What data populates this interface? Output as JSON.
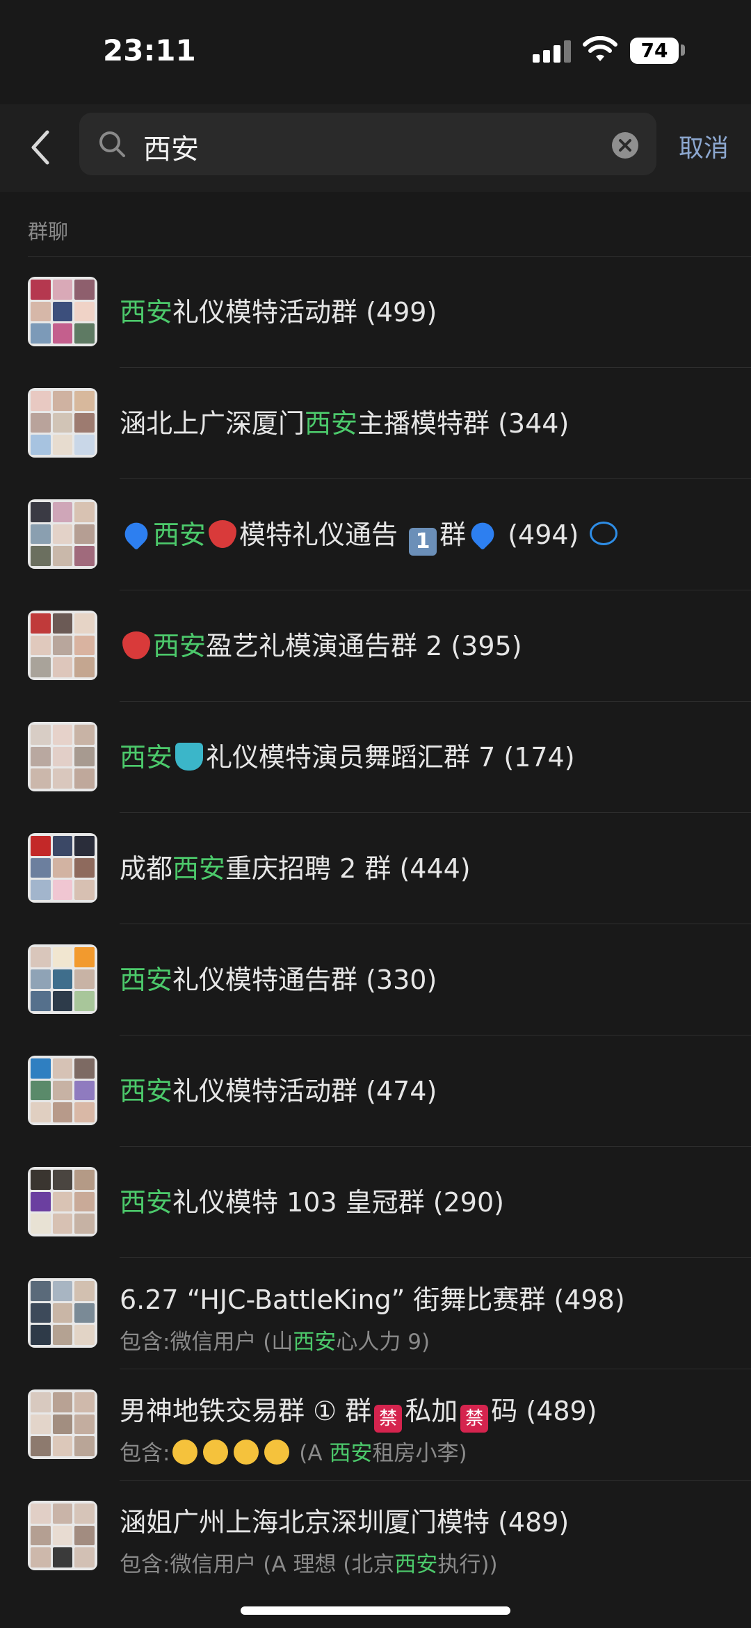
{
  "status_bar": {
    "time": "23:11",
    "battery": "74"
  },
  "search": {
    "query": "西安",
    "cancel_label": "取消"
  },
  "section_title": "群聊",
  "results": [
    {
      "parts": [
        {
          "t": "西安",
          "hl": true
        },
        {
          "t": "礼仪模特活动群 (499)"
        }
      ],
      "sub": null,
      "avatar": [
        "#b5384f",
        "#d9a9b7",
        "#8e5f6d",
        "#d6b7a8",
        "#3c4f7c",
        "#f0d3c7",
        "#7c9ab8",
        "#c45f8d",
        "#5e7a63"
      ]
    },
    {
      "parts": [
        {
          "t": "涵北上广深厦门"
        },
        {
          "t": "西安",
          "hl": true
        },
        {
          "t": "主播模特群 (344)"
        }
      ],
      "sub": null,
      "avatar": [
        "#e8c9c2",
        "#cfb2a1",
        "#d7b89c",
        "#b9a39b",
        "#d1c4b6",
        "#9d7b70",
        "#a7c3e0",
        "#e7dccf",
        "#c9d7e8"
      ]
    },
    {
      "parts": [
        {
          "e": "heart"
        },
        {
          "t": "西安",
          "hl": true
        },
        {
          "e": "straw"
        },
        {
          "t": "模特礼仪通告 "
        },
        {
          "e": "one",
          "t": "1"
        },
        {
          "t": "群"
        },
        {
          "e": "heart"
        },
        {
          "t": " (494) "
        },
        {
          "e": "chat"
        }
      ],
      "sub": null,
      "avatar": [
        "#3a3a44",
        "#cfa6b8",
        "#d8c2b2",
        "#8a9fb0",
        "#e3d2c8",
        "#b59e93",
        "#6b6f5f",
        "#c9b8aa",
        "#a06a7c"
      ]
    },
    {
      "parts": [
        {
          "e": "straw"
        },
        {
          "t": "西安",
          "hl": true
        },
        {
          "t": "盈艺礼模演通告群 2 (395)"
        }
      ],
      "sub": null,
      "avatar": [
        "#c03a3a",
        "#6b5a55",
        "#e6d4c6",
        "#e0c9bd",
        "#b8a69c",
        "#d9b3a0",
        "#a9a39a",
        "#ddc6bb",
        "#c4a690"
      ]
    },
    {
      "parts": [
        {
          "t": "西安",
          "hl": true
        },
        {
          "e": "dress"
        },
        {
          "t": "礼仪模特演员舞蹈汇群 7 (174)"
        }
      ],
      "sub": null,
      "avatar": [
        "#d8cdc5",
        "#e6d2ca",
        "#c8b3a5",
        "#b9a8a0",
        "#e2cfc8",
        "#a79a90",
        "#cbb7ab",
        "#d9c7bd",
        "#bfa89b"
      ]
    },
    {
      "parts": [
        {
          "t": "成都"
        },
        {
          "t": "西安",
          "hl": true
        },
        {
          "t": "重庆招聘 2 群 (444)"
        }
      ],
      "sub": null,
      "avatar": [
        "#c32828",
        "#3b4866",
        "#2a2d3a",
        "#6c7f9e",
        "#d2b3a2",
        "#8e6a5d",
        "#a2b5cc",
        "#f0c6d2",
        "#d7c0b2"
      ]
    },
    {
      "parts": [
        {
          "t": "西安",
          "hl": true
        },
        {
          "t": "礼仪模特通告群 (330)"
        }
      ],
      "sub": null,
      "avatar": [
        "#d9c6bb",
        "#f1e6d0",
        "#f29a2e",
        "#8fa3b6",
        "#3f6e8c",
        "#c8b3a5",
        "#55708c",
        "#2d3b4a",
        "#a8c69a"
      ]
    },
    {
      "parts": [
        {
          "t": "西安",
          "hl": true
        },
        {
          "t": "礼仪模特活动群 (474)"
        }
      ],
      "sub": null,
      "avatar": [
        "#2f7fc1",
        "#d6c2b5",
        "#7d6a63",
        "#5a8a6a",
        "#c7b2a4",
        "#8f7bbf",
        "#e0cfc1",
        "#b79a8a",
        "#d9b8a6"
      ]
    },
    {
      "parts": [
        {
          "t": "西安",
          "hl": true
        },
        {
          "t": "礼仪模特 103 皇冠群 (290)"
        }
      ],
      "sub": null,
      "avatar": [
        "#3a3530",
        "#4a4540",
        "#b49a86",
        "#6b3fa0",
        "#d9c3b4",
        "#c9aa98",
        "#e8e2d4",
        "#d7c1b3",
        "#c6b2a4"
      ]
    },
    {
      "parts": [
        {
          "t": "6.27 “HJC-BattleKing” 街舞比赛群 (498)"
        }
      ],
      "sub": [
        {
          "t": "包含:微信用户 (山"
        },
        {
          "t": "西安",
          "hl": true
        },
        {
          "t": "心人力 9)"
        }
      ],
      "avatar": [
        "#5a6a7a",
        "#a8b5c2",
        "#d2c0b0",
        "#3d4a5a",
        "#c9b6a6",
        "#7a8a96",
        "#2e3a48",
        "#b4a292",
        "#e2d4c6"
      ]
    },
    {
      "parts": [
        {
          "t": "男神地铁交易群 ① 群"
        },
        {
          "e": "ban",
          "t": "禁"
        },
        {
          "t": "私加"
        },
        {
          "e": "ban",
          "t": "禁"
        },
        {
          "t": "码 (489)"
        }
      ],
      "sub": [
        {
          "t": "包含:"
        },
        {
          "e": "face"
        },
        {
          "e": "face"
        },
        {
          "e": "face"
        },
        {
          "e": "face"
        },
        {
          "t": " (A "
        },
        {
          "t": "西安",
          "hl": true
        },
        {
          "t": "租房小李)"
        }
      ],
      "avatar": [
        "#d8c9bf",
        "#b8a294",
        "#cfb9ab",
        "#e3d5ca",
        "#a28e80",
        "#c3ad9f",
        "#8d7a6e",
        "#dcc8ba",
        "#b9a597"
      ]
    },
    {
      "parts": [
        {
          "t": "涵姐广州上海北京深圳厦门模特 (489)"
        }
      ],
      "sub": [
        {
          "t": "包含:微信用户 (A 理想 (北京"
        },
        {
          "t": "西安",
          "hl": true
        },
        {
          "t": "执行))"
        }
      ],
      "avatar": [
        "#e1cfc6",
        "#c9b4a8",
        "#d6c4b8",
        "#b49f92",
        "#e8dcd2",
        "#a28c80",
        "#cdb8ab",
        "#3a3a3a",
        "#d2c0b4"
      ]
    }
  ]
}
